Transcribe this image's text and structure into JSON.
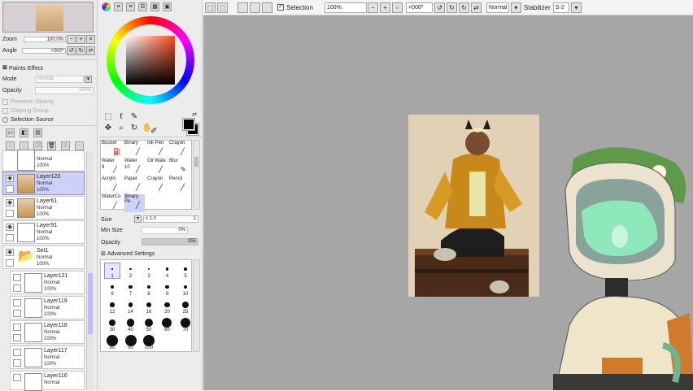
{
  "navigator": {
    "zoom_label": "Zoom",
    "zoom_value": "100.0%",
    "angle_label": "Angle",
    "angle_value": "+000º"
  },
  "paints_effect": {
    "header": "Paints Effect",
    "mode_label": "Mode",
    "mode_value": "Normal",
    "opacity_label": "Opacity",
    "opacity_value": "100%",
    "preserve_opacity": "Preserve Opacity",
    "clipping_group": "Clipping Group",
    "selection_source": "Selection Source"
  },
  "layers": [
    {
      "name": "Layer123",
      "mode": "Normal",
      "opacity": "100%",
      "selected": true
    },
    {
      "name": "Layer61",
      "mode": "Normal",
      "opacity": "100%"
    },
    {
      "name": "Layer91",
      "mode": "Normal",
      "opacity": "100%"
    },
    {
      "name": "Set1",
      "mode": "Normal",
      "opacity": "100%"
    },
    {
      "name": "Layer121",
      "mode": "Normal",
      "opacity": "100%"
    },
    {
      "name": "Layer119",
      "mode": "Normal",
      "opacity": "100%"
    },
    {
      "name": "Layer118",
      "mode": "Normal",
      "opacity": "100%"
    },
    {
      "name": "Layer117",
      "mode": "Normal",
      "opacity": "100%"
    },
    {
      "name": "Layer116",
      "mode": "Normal",
      "opacity": "100%"
    }
  ],
  "layer_partial_top": {
    "mode": "Normal",
    "opacity": "100%"
  },
  "brushes": [
    "Bucket",
    "Binary",
    "Ink Pen",
    "Crayon",
    "Water",
    "Water",
    "Oil Wate",
    "Blur",
    "Acrylic",
    "Paper",
    "Crayon",
    "Pencil",
    "WaterCo",
    "Binary Pe"
  ],
  "brush_numbers": [
    "9",
    "10"
  ],
  "brush_settings": {
    "size_label": "Size",
    "size_value": "x 1.0",
    "size_num": "1",
    "min_size_label": "Min Size",
    "min_size_value": "0%",
    "opacity_label": "Opacity",
    "opacity_value": "255",
    "advanced": "Advanced Settings"
  },
  "dot_sizes": [
    "1",
    "2",
    "3",
    "4",
    "5",
    "6",
    "7",
    "8",
    "9",
    "10",
    "12",
    "14",
    "16",
    "20",
    "25",
    "30",
    "40",
    "50",
    "60",
    "70",
    "80",
    "90",
    "100"
  ],
  "toolbar": {
    "selection_label": "Selection",
    "zoom_value": "100%",
    "angle_value": "+000º",
    "blend_value": "Normal",
    "stabilizer_label": "Stabilizer",
    "stabilizer_value": "S-2"
  },
  "colors": {
    "canvas": "#a6a6a6",
    "selected_layer": "#cdd0f7",
    "fg_color": "#000000"
  }
}
